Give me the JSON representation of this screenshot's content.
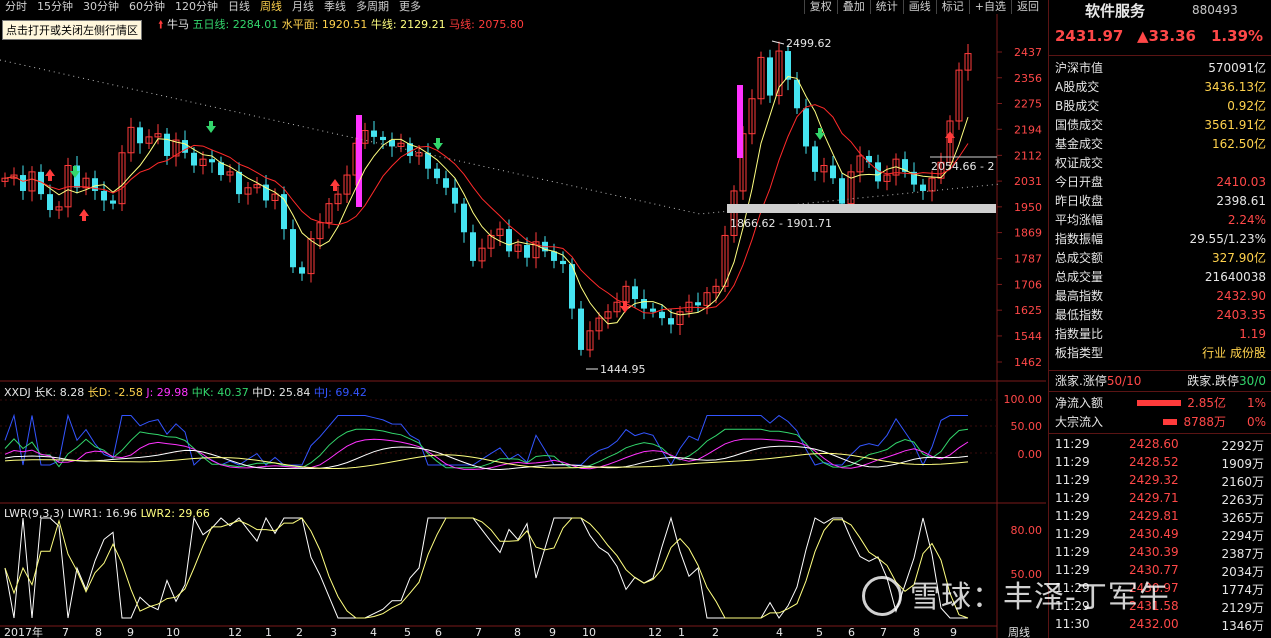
{
  "tabs": [
    "分时",
    "15分钟",
    "30分钟",
    "60分钟",
    "120分钟",
    "日线",
    "周线",
    "月线",
    "季线",
    "多周期",
    "更多"
  ],
  "active_tab": "周线",
  "toolbar_right": [
    "复权",
    "叠加",
    "统计",
    "画线",
    "标记",
    "+自选",
    "返回"
  ],
  "tooltip": "点击打开或关闭左侧行情区",
  "legend_main": {
    "title": "牛马",
    "l1": "五日线: 2284.01",
    "l2": "水平面: 1920.51",
    "l3": "牛线: 2129.21",
    "l4": "马线: 2075.80"
  },
  "legend_kdj": {
    "title": "XXDJ",
    "k": "长K: 8.28",
    "d": "长D: -2.58",
    "j": "J: 29.98",
    "mk": "中K: 40.37",
    "md": "中D: 25.84",
    "mj": "中J: 69.42"
  },
  "legend_lwr": {
    "title": "LWR(9,3,3)",
    "l1": "LWR1: 16.96",
    "l2": "LWR2: 29.66"
  },
  "axis_main": [
    "2437",
    "2356",
    "2275",
    "2194",
    "2112",
    "2031",
    "1950",
    "1869",
    "1787",
    "1706",
    "1625",
    "1544",
    "1462"
  ],
  "axis_kdj": [
    "100.00",
    "50.00",
    "0.00"
  ],
  "axis_lwr": [
    "80.00",
    "50.00"
  ],
  "x_labels": [
    "2017年",
    "7",
    "8",
    "9",
    "10",
    "12",
    "1",
    "2",
    "3",
    "4",
    "5",
    "6",
    "7",
    "8",
    "9",
    "10",
    "12",
    "1",
    "2",
    "4",
    "5",
    "6",
    "7",
    "8",
    "9"
  ],
  "period_label": "周线",
  "annot": {
    "high": "2499.62",
    "low": "1444.95",
    "band": "1866.62 - 1901.71",
    "right": "2054.66 - 2"
  },
  "index": {
    "name": "软件服务",
    "code": "880493",
    "price": "2431.97",
    "change": "▲33.36",
    "pct": "1.39%"
  },
  "stats": [
    {
      "label": "沪深市值",
      "value": "570091亿",
      "color": "wht"
    },
    {
      "label": "A股成交",
      "value": "3436.13亿",
      "color": "yel"
    },
    {
      "label": "B股成交",
      "value": "0.92亿",
      "color": "yel"
    },
    {
      "label": "国债成交",
      "value": "3561.91亿",
      "color": "yel"
    },
    {
      "label": "基金成交",
      "value": "162.50亿",
      "color": "yel"
    },
    {
      "label": "权证成交",
      "value": "",
      "color": "yel"
    },
    {
      "label": "今日开盘",
      "value": "2410.03",
      "color": "red"
    },
    {
      "label": "昨日收盘",
      "value": "2398.61",
      "color": "wht"
    },
    {
      "label": "平均涨幅",
      "value": "2.24%",
      "color": "red"
    },
    {
      "label": "指数振幅",
      "value": "29.55/1.23%",
      "color": "wht"
    },
    {
      "label": "总成交额",
      "value": "327.90亿",
      "color": "yel"
    },
    {
      "label": "总成交量",
      "value": "21640038",
      "color": "wht"
    },
    {
      "label": "最高指数",
      "value": "2432.90",
      "color": "red"
    },
    {
      "label": "最低指数",
      "value": "2403.35",
      "color": "red"
    },
    {
      "label": "指数量比",
      "value": "1.19",
      "color": "red"
    },
    {
      "label": "板指类型",
      "value": "行业 成份股",
      "color": "yel"
    }
  ],
  "limit": {
    "up_label": "涨家.涨停",
    "up_value": "50/10",
    "down_label": "跌家.跌停",
    "down_value": "30/0"
  },
  "flows": [
    {
      "label": "净流入额",
      "value": "2.85亿",
      "pct": "1%"
    },
    {
      "label": "大宗流入",
      "value": "8788万",
      "pct": "0%"
    }
  ],
  "ticks": [
    {
      "t": "11:29",
      "p": "2428.60",
      "v": "2292万"
    },
    {
      "t": "11:29",
      "p": "2428.52",
      "v": "1909万"
    },
    {
      "t": "11:29",
      "p": "2429.32",
      "v": "2160万"
    },
    {
      "t": "11:29",
      "p": "2429.71",
      "v": "2263万"
    },
    {
      "t": "11:29",
      "p": "2429.81",
      "v": "3265万"
    },
    {
      "t": "11:29",
      "p": "2430.49",
      "v": "2294万"
    },
    {
      "t": "11:29",
      "p": "2430.39",
      "v": "2387万"
    },
    {
      "t": "11:29",
      "p": "2430.77",
      "v": "2034万"
    },
    {
      "t": "11:29",
      "p": "2430.97",
      "v": "1774万"
    },
    {
      "t": "11:29",
      "p": "2431.58",
      "v": "2129万"
    },
    {
      "t": "11:30",
      "p": "2432.00",
      "v": "1346万"
    }
  ],
  "watermark": "雪球：丰泽-丁军午",
  "colors": {
    "up": "#ff3b3b",
    "down": "#45e3f0",
    "ma5": "#ffff80",
    "ma2": "#ff2a2a",
    "magenta": "#ff33ff"
  }
}
